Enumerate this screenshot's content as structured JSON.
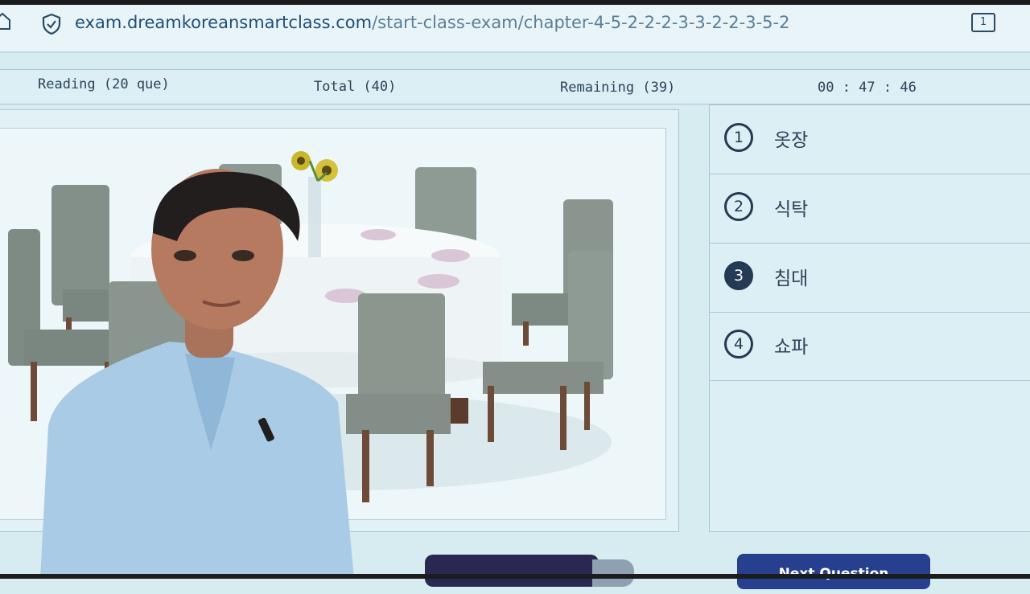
{
  "browser": {
    "url_domain": "exam.dreamkoreansmartclass.com",
    "url_path": "/start-class-exam/chapter-4-5-2-2-2-3-3-2-2-3-5-2",
    "tab_count": "1"
  },
  "exam_header": {
    "section": "Reading (20 que)",
    "total": "Total (40)",
    "remaining": "Remaining (39)",
    "timer": "00 : 47 : 46"
  },
  "question": {
    "image": "dining-table-with-chairs",
    "options": [
      {
        "number": "1",
        "label": "옷장",
        "selected": false
      },
      {
        "number": "2",
        "label": "식탁",
        "selected": false
      },
      {
        "number": "3",
        "label": "침대",
        "selected": true
      },
      {
        "number": "4",
        "label": "쇼파",
        "selected": false
      }
    ]
  },
  "footer": {
    "next_button": "Next Question"
  },
  "colors": {
    "page_bg": "#d6ecf1",
    "accent": "#263f8e",
    "selected_option": "#243a55"
  }
}
